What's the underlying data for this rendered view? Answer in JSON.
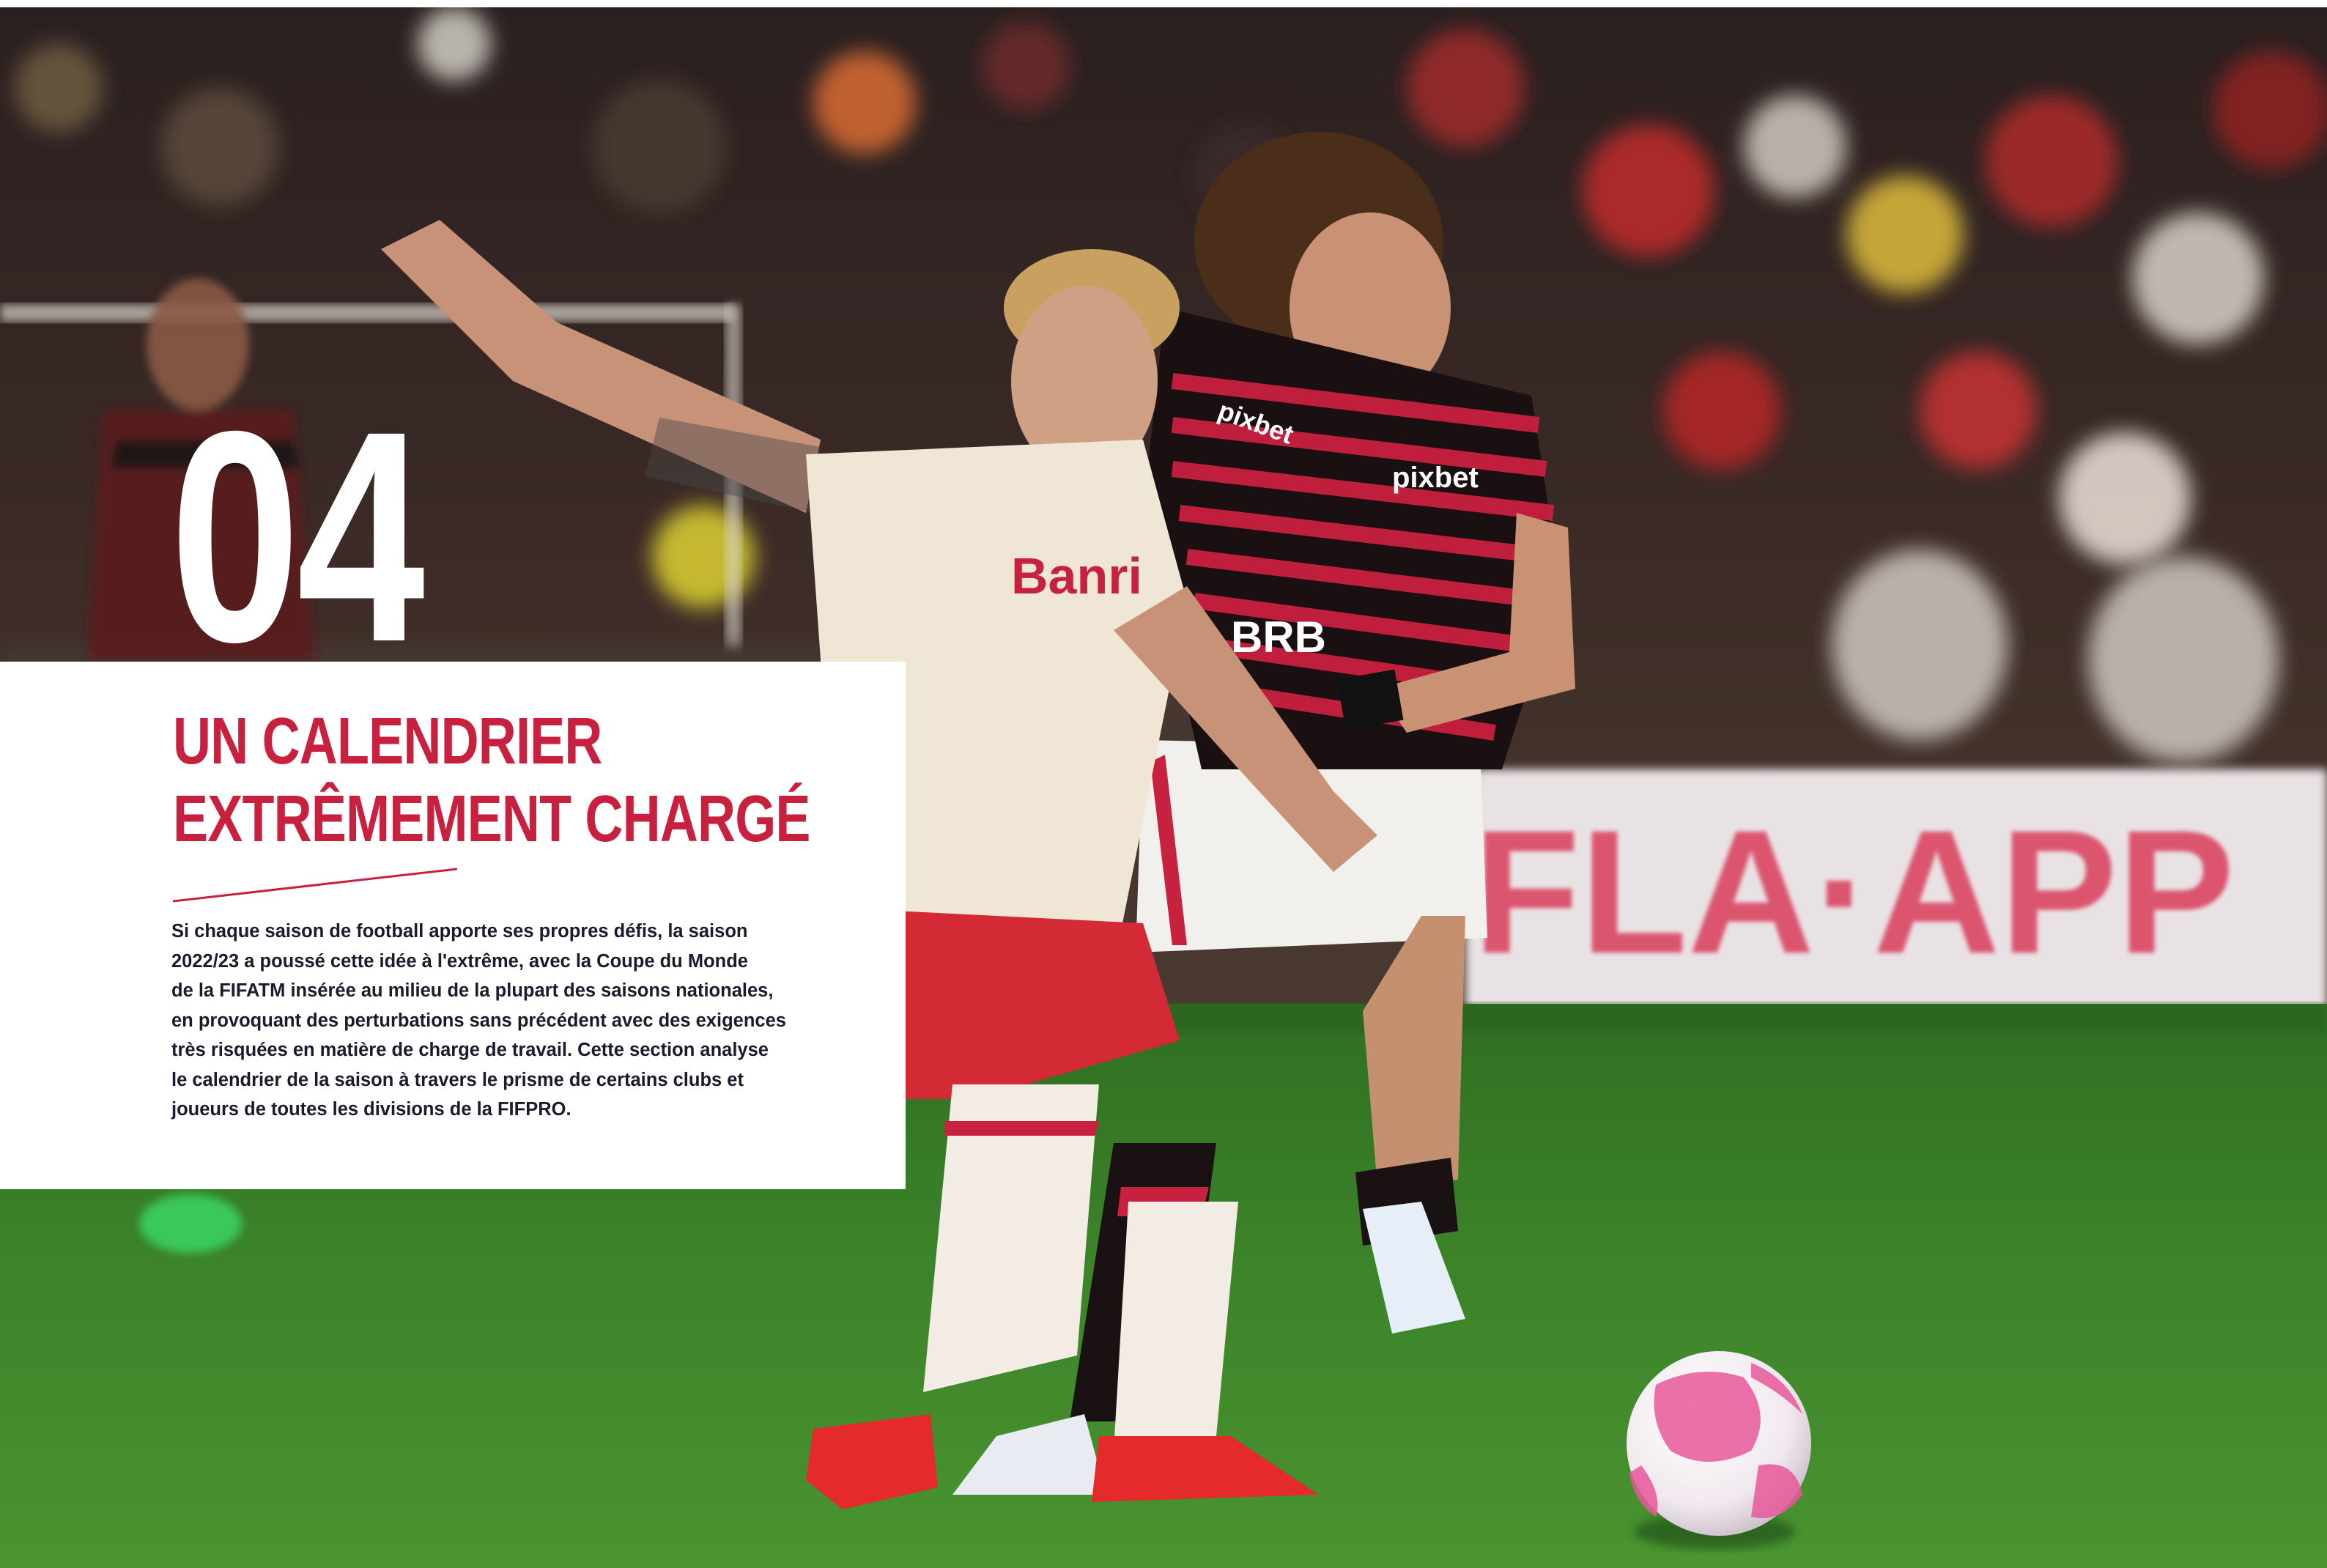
{
  "chapter": {
    "number": "04",
    "title_lines": [
      "UN CALENDRIER",
      "EXTRÊMEMENT CHARGÉ"
    ],
    "intro_lines": [
      "Si chaque saison de football apporte ses propres défis, la saison",
      "2022/23 a poussé cette idée à l'extrême, avec la Coupe du Monde",
      "de la FIFATM insérée au milieu de la plupart des saisons nationales,",
      "en provoquant des perturbations sans précédent avec des exigences",
      "très risquées en matière de charge de travail. Cette section analyse",
      "le calendrier de la saison à travers le prisme de certains clubs et",
      "joueurs de toutes les divisions de la FIFPRO."
    ]
  },
  "photo": {
    "description_icon": "football-match-photo",
    "shirt_sponsors": [
      "Banrisul",
      "pixbet",
      "pixbet",
      "banco BRB"
    ],
    "banner_text": "FLA·APP"
  },
  "colors": {
    "accent": "#c8203f",
    "body_text": "#1b1b2b",
    "panel_bg": "#ffffff",
    "pitch": "#3f8a2c"
  }
}
